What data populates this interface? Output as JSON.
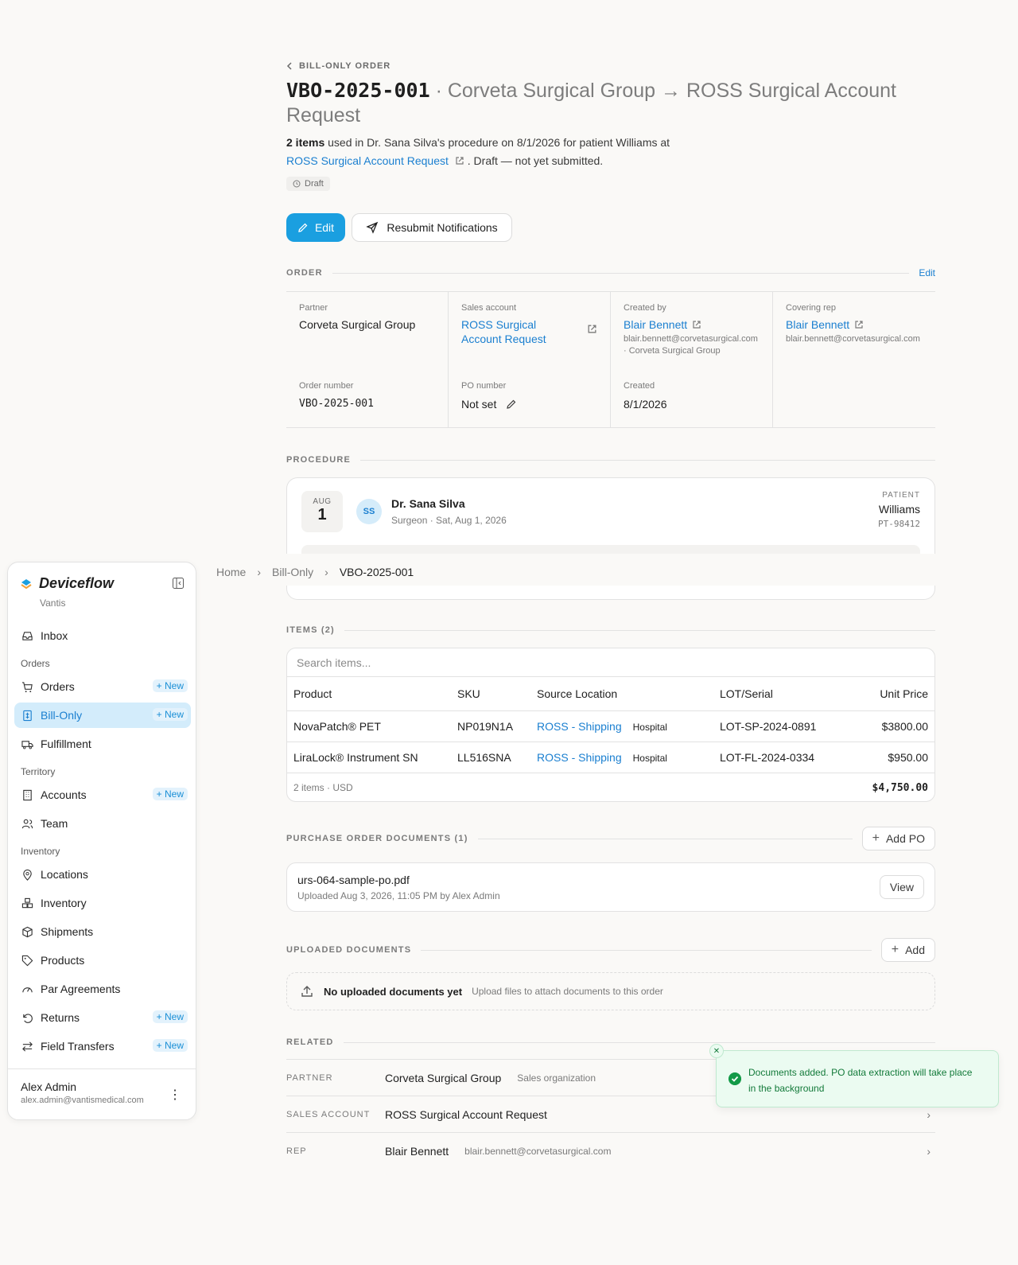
{
  "header": {
    "back_label": "BILL-ONLY ORDER",
    "order_code": "VBO-2025-001",
    "title_rest": " · Corveta Surgical Group → ROSS Surgical Account Request",
    "summary_count": "2 items",
    "summary_text": " used in Dr. Sana Silva's procedure on 8/1/2026 for patient Williams at",
    "summary_link": "ROSS Surgical Account Request",
    "summary_tail": ". Draft — not yet submitted.",
    "status": "Draft",
    "edit_label": "Edit",
    "resubmit_label": "Resubmit Notifications"
  },
  "order": {
    "section": "ORDER",
    "edit": "Edit",
    "partner_label": "Partner",
    "partner": "Corveta Surgical Group",
    "sales_label": "Sales account",
    "sales": "ROSS Surgical Account Request",
    "created_by_label": "Created by",
    "created_by": "Blair Bennett",
    "created_by_sub": "blair.bennett@corvetasurgical.com · Corveta Surgical Group",
    "rep_label": "Covering rep",
    "rep": "Blair Bennett",
    "rep_sub": "blair.bennett@corvetasurgical.com",
    "order_number_label": "Order number",
    "order_number": "VBO-2025-001",
    "po_label": "PO number",
    "po": "Not set",
    "created_label": "Created",
    "created": "8/1/2026"
  },
  "procedure": {
    "section": "PROCEDURE",
    "month": "AUG",
    "day": "1",
    "initials": "SS",
    "surgeon": "Dr. Sana Silva",
    "surgeon_sub": "Surgeon · Sat, Aug 1, 2026",
    "patient_label": "PATIENT",
    "patient": "Williams",
    "patient_id": "PT-98412"
  },
  "breadcrumb": {
    "home": "Home",
    "section": "Bill-Only",
    "current": "VBO-2025-001"
  },
  "items": {
    "section": "ITEMS (2)",
    "search_placeholder": "Search items...",
    "columns": [
      "Product",
      "SKU",
      "Source Location",
      "LOT/Serial",
      "Unit Price"
    ],
    "rows": [
      {
        "product": "NovaPatch® PET",
        "sku": "NP019N1A",
        "location": "ROSS - Shipping",
        "tag": "Hospital",
        "lot": "LOT-SP-2024-0891",
        "price": "$3800.00"
      },
      {
        "product": "LiraLock® Instrument SN",
        "sku": "LL516SNA",
        "location": "ROSS - Shipping",
        "tag": "Hospital",
        "lot": "LOT-FL-2024-0334",
        "price": "$950.00"
      }
    ],
    "footer_count": "2 items · USD",
    "total": "$4,750.00"
  },
  "po_docs": {
    "section": "PURCHASE ORDER DOCUMENTS (1)",
    "add": "Add PO",
    "file": "urs-064-sample-po.pdf",
    "meta": "Uploaded Aug 3, 2026, 11:05 PM by Alex Admin",
    "view": "View"
  },
  "uploads": {
    "section": "UPLOADED DOCUMENTS",
    "add": "Add",
    "empty_title": "No uploaded documents yet",
    "empty_sub": "Upload files to attach documents to this order"
  },
  "related": {
    "section": "RELATED",
    "rows": [
      {
        "key": "PARTNER",
        "value": "Corveta Surgical Group",
        "sub": "Sales organization"
      },
      {
        "key": "SALES ACCOUNT",
        "value": "ROSS Surgical Account Request",
        "sub": ""
      },
      {
        "key": "REP",
        "value": "Blair Bennett",
        "sub": "blair.bennett@corvetasurgical.com"
      }
    ]
  },
  "sidebar": {
    "brand": "Deviceflow",
    "org": "Vantis",
    "inbox": "Inbox",
    "group_orders": "Orders",
    "orders": "Orders",
    "bill_only": "Bill-Only",
    "fulfillment": "Fulfillment",
    "group_territory": "Territory",
    "accounts": "Accounts",
    "team": "Team",
    "group_inventory": "Inventory",
    "locations": "Locations",
    "inventory": "Inventory",
    "shipments": "Shipments",
    "products": "Products",
    "par": "Par Agreements",
    "returns": "Returns",
    "field_transfers": "Field Transfers",
    "new": "+ New",
    "user_name": "Alex Admin",
    "user_email": "alex.admin@vantismedical.com"
  },
  "toast": {
    "message": "Documents added. PO data extraction will take place in the background"
  },
  "colors": {
    "accent": "#1a9fe0",
    "link": "#1a7fd0",
    "success": "#139a48"
  }
}
